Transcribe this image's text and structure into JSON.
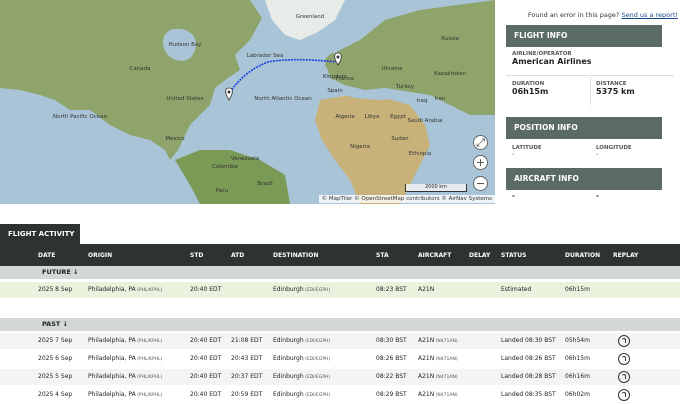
{
  "error_link": {
    "prefix": "Found an error in this page?",
    "link": "Send us a report!"
  },
  "map": {
    "attribution": "© MapTiler © OpenStreetMap contributors © AirNav Systems",
    "scale": "2000 km",
    "labels": {
      "hudson": "Hudson Bay",
      "labrador": "Labrador Sea",
      "north_atlantic": "North Atlantic Ocean",
      "north_pacific": "North Pacific Ocean",
      "united_states": "United States",
      "canada": "Canada",
      "greenland": "Greenland",
      "mexico": "Mexico",
      "brazil": "Brazil",
      "russia": "Russia",
      "kazakhstan": "Kazakhstan",
      "algeria": "Algeria",
      "libya": "Libya",
      "egypt": "Egypt",
      "saudi": "Saudi Arabia",
      "sudan": "Sudan",
      "nigeria": "Nigeria",
      "ethiopia": "Ethiopia",
      "kingdom": "Kingdom",
      "ukraine": "Ukraine",
      "france": "France",
      "spain": "Spain",
      "iran": "Iran",
      "iraq": "Iraq",
      "turkey": "Turkey",
      "peru": "Peru",
      "colombia": "Colombia",
      "venezuela": "Venezuela"
    },
    "controls": {
      "fit": "⤢",
      "zoom_in": "+",
      "zoom_out": "−"
    },
    "colors": {
      "route": "#1a3fe0",
      "ocean": "#a8c4d6",
      "land": "#8fa46a"
    }
  },
  "flight_info": {
    "header": "FLIGHT INFO",
    "airline_label": "AIRLINE/OPERATOR",
    "airline": "American Airlines",
    "duration_label": "DURATION",
    "duration": "06h15m",
    "distance_label": "DISTANCE",
    "distance": "5375 km"
  },
  "position_info": {
    "header": "POSITION INFO",
    "lat_label": "LATITUDE",
    "lat": "-",
    "lon_label": "LONGITUDE",
    "lon": "-"
  },
  "aircraft_info": {
    "header": "AIRCRAFT INFO",
    "val1": "-",
    "val2": "-"
  },
  "activity": {
    "tab": "FLIGHT ACTIVITY",
    "columns": [
      "DATE",
      "ORIGIN",
      "STD",
      "ATD",
      "DESTINATION",
      "STA",
      "AIRCRAFT",
      "DELAY",
      "STATUS",
      "DURATION",
      "REPLAY"
    ],
    "future_label": "FUTURE ↓",
    "past_label": "PAST ↓",
    "future": [
      {
        "date": "2025 8 Sep",
        "origin": "Philadelphia, PA",
        "origin_code": "(PHL/KPHL)",
        "std": "20:40 EDT",
        "atd": "",
        "dest": "Edinburgh",
        "dest_code": "(EDI/EGPH)",
        "sta": "08:23 BST",
        "aircraft": "A21N",
        "reg": "",
        "delay": "",
        "status": "Estimated",
        "duration": "06h15m"
      }
    ],
    "past": [
      {
        "date": "2025 7 Sep",
        "origin": "Philadelphia, PA",
        "origin_code": "(PHL/KPHL)",
        "std": "20:40 EDT",
        "atd": "21:08 EDT",
        "dest": "Edinburgh",
        "dest_code": "(EDI/EGPH)",
        "sta": "08:30 BST",
        "aircraft": "A21N",
        "reg": "(N471AN)",
        "delay": "",
        "status": "Landed 08:30 BST",
        "duration": "05h54m"
      },
      {
        "date": "2025 6 Sep",
        "origin": "Philadelphia, PA",
        "origin_code": "(PHL/KPHL)",
        "std": "20:40 EDT",
        "atd": "20:43 EDT",
        "dest": "Edinburgh",
        "dest_code": "(EDI/EGPH)",
        "sta": "08:26 BST",
        "aircraft": "A21N",
        "reg": "(N471AN)",
        "delay": "",
        "status": "Landed 08:26 BST",
        "duration": "06h15m"
      },
      {
        "date": "2025 5 Sep",
        "origin": "Philadelphia, PA",
        "origin_code": "(PHL/KPHL)",
        "std": "20:40 EDT",
        "atd": "20:37 EDT",
        "dest": "Edinburgh",
        "dest_code": "(EDI/EGPH)",
        "sta": "08:22 BST",
        "aircraft": "A21N",
        "reg": "(N471AN)",
        "delay": "",
        "status": "Landed 08:28 BST",
        "duration": "06h16m"
      },
      {
        "date": "2025 4 Sep",
        "origin": "Philadelphia, PA",
        "origin_code": "(PHL/KPHL)",
        "std": "20:40 EDT",
        "atd": "20:59 EDT",
        "dest": "Edinburgh",
        "dest_code": "(EDI/EGPH)",
        "sta": "08:29 BST",
        "aircraft": "A21N",
        "reg": "(N471AN)",
        "delay": "",
        "status": "Landed 08:35 BST",
        "duration": "06h02m"
      }
    ]
  }
}
